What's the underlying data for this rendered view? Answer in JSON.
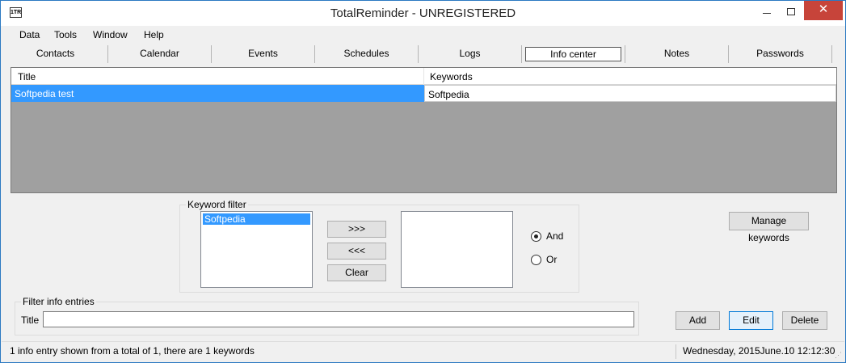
{
  "window": {
    "title": "TotalReminder - UNREGISTERED",
    "app_icon_text": "1TR",
    "minimize_icon": "minimize-icon",
    "maximize_icon": "maximize-icon",
    "close_icon": "close-icon",
    "close_glyph": "✕"
  },
  "menu": {
    "items": [
      "Data",
      "Tools",
      "Window",
      "Help"
    ]
  },
  "tabs": {
    "items": [
      "Contacts",
      "Calendar",
      "Events",
      "Schedules",
      "Logs",
      "Info center",
      "Notes",
      "Passwords"
    ],
    "active": "Info center"
  },
  "grid": {
    "columns": [
      "Title",
      "Keywords"
    ],
    "rows": [
      {
        "title": "Softpedia test",
        "keywords": "Softpedia"
      }
    ]
  },
  "keyword_filter": {
    "legend": "Keyword filter",
    "available": [
      "Softpedia"
    ],
    "selected": [],
    "add_label": ">>>",
    "remove_label": "<<<",
    "clear_label": "Clear",
    "and_label": "And",
    "or_label": "Or",
    "mode": "And"
  },
  "manage_keywords_label": "Manage keywords",
  "filter_entries": {
    "legend": "Filter info entries",
    "title_label": "Title",
    "title_value": ""
  },
  "actions": {
    "add_label": "Add",
    "edit_label": "Edit",
    "delete_label": "Delete"
  },
  "status": {
    "left": "1 info entry shown from a total of 1, there are 1 keywords",
    "right": "Wednesday, 2015June.10 12:12:30"
  },
  "colors": {
    "selection": "#3399ff",
    "close_button": "#c7443a",
    "grid_background": "#a0a0a0"
  }
}
